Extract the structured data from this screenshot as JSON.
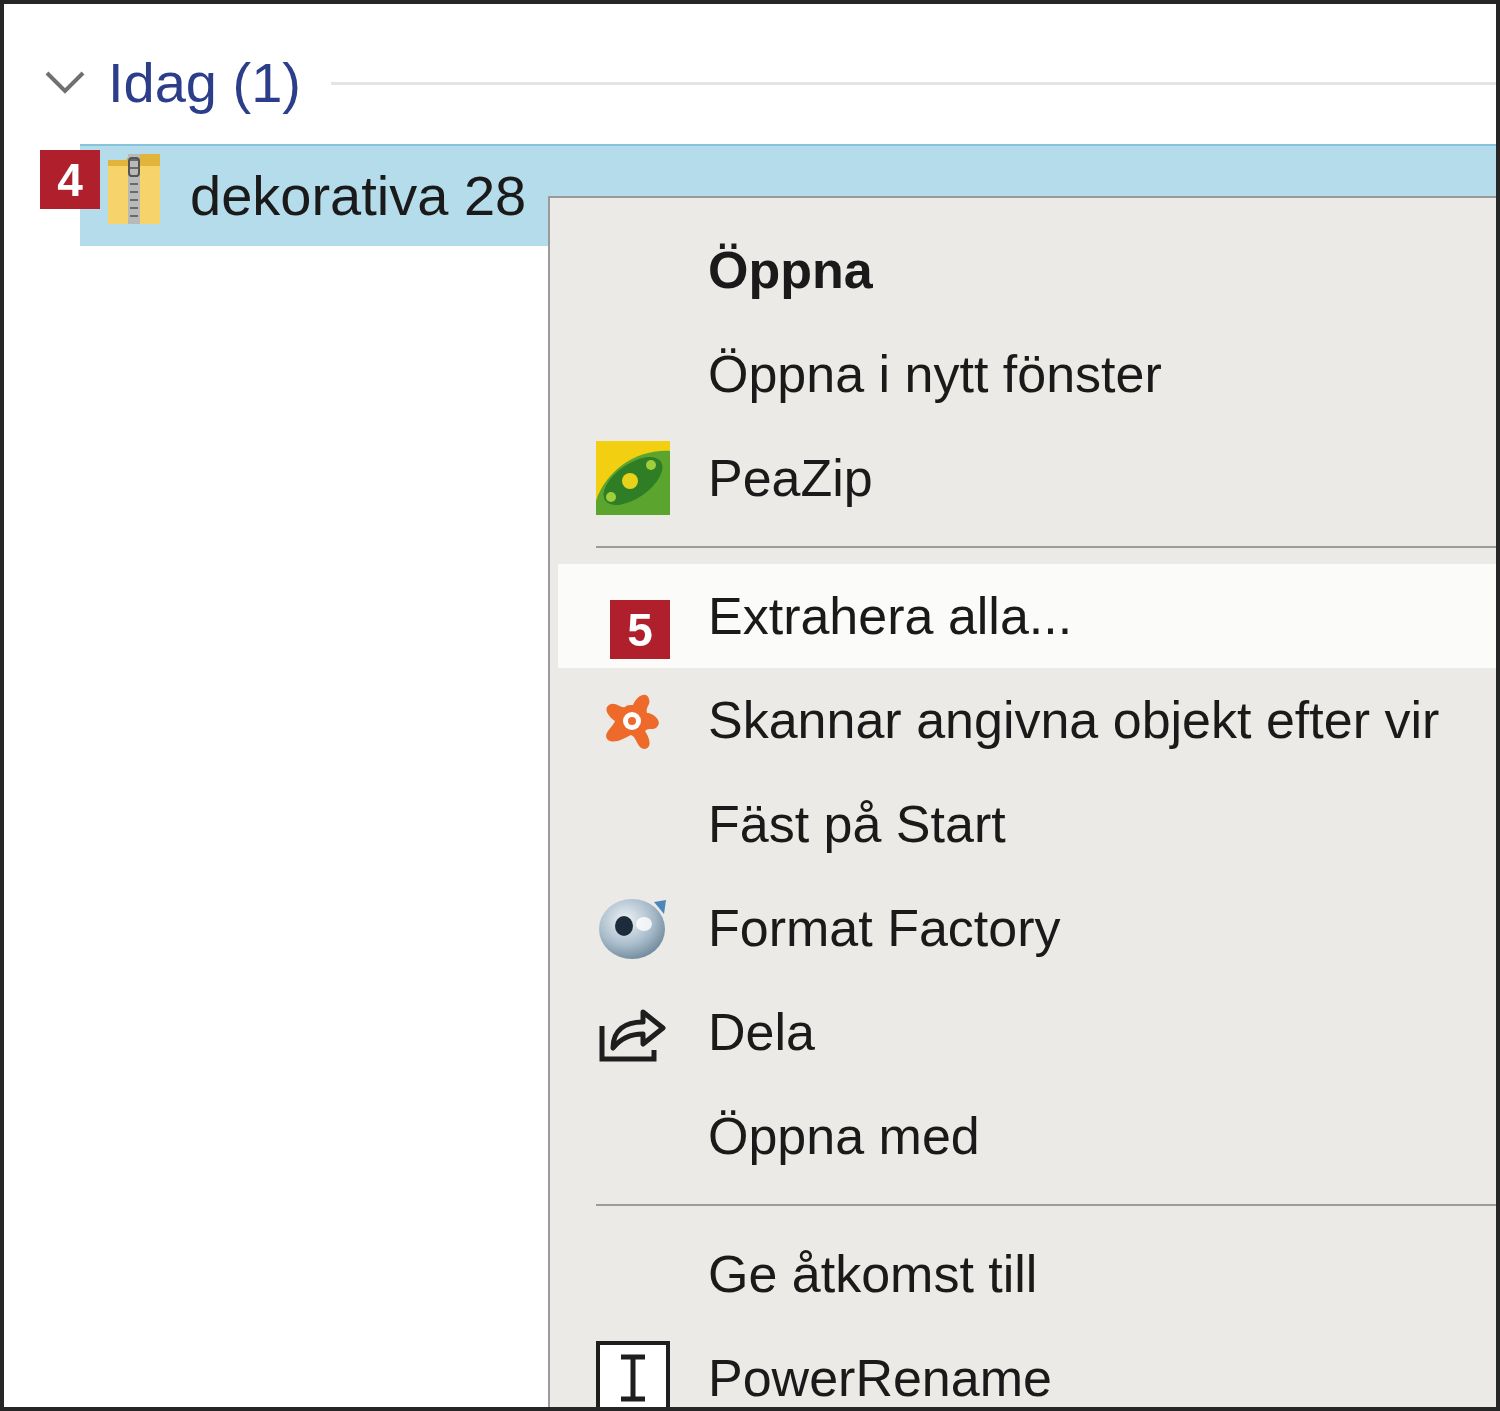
{
  "group": {
    "title": "Idag (1)",
    "expanded": true
  },
  "files": [
    {
      "name": "dekorativa 28",
      "selected": true,
      "callout": "4"
    }
  ],
  "context_menu": {
    "items": [
      {
        "kind": "item",
        "label": "Öppna",
        "default": true,
        "highlighted": false
      },
      {
        "kind": "item",
        "label": "Öppna i nytt fönster",
        "default": false,
        "highlighted": false
      },
      {
        "kind": "item",
        "label": "PeaZip",
        "default": false,
        "highlighted": false
      },
      {
        "kind": "separator"
      },
      {
        "kind": "item",
        "label": "Extrahera alla...",
        "default": false,
        "highlighted": true,
        "callout": "5"
      },
      {
        "kind": "item",
        "label": "Skannar angivna objekt efter vir",
        "default": false,
        "highlighted": false
      },
      {
        "kind": "item",
        "label": "Fäst på Start",
        "default": false,
        "highlighted": false
      },
      {
        "kind": "item",
        "label": "Format Factory",
        "default": false,
        "highlighted": false
      },
      {
        "kind": "item",
        "label": "Dela",
        "default": false,
        "highlighted": false
      },
      {
        "kind": "item",
        "label": "Öppna med",
        "default": false,
        "highlighted": false
      },
      {
        "kind": "separator"
      },
      {
        "kind": "item",
        "label": "Ge åtkomst till",
        "default": false,
        "highlighted": false
      },
      {
        "kind": "item",
        "label": "PowerRename",
        "default": false,
        "highlighted": false
      }
    ]
  }
}
